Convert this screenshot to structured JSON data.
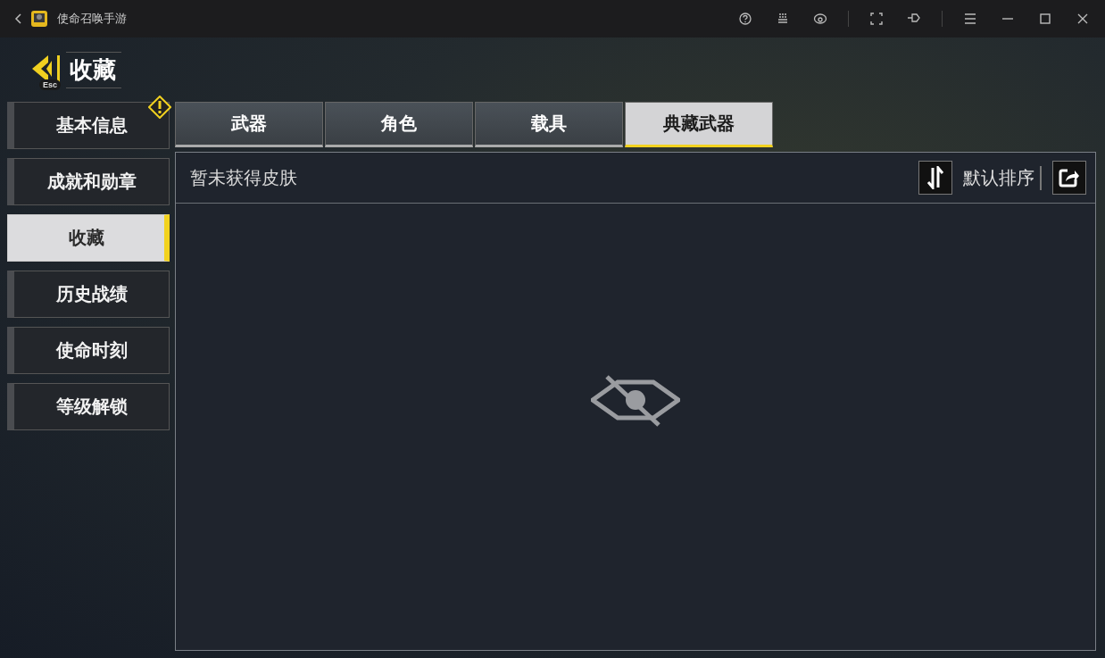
{
  "window": {
    "title": "使命召唤手游"
  },
  "header": {
    "title": "收藏",
    "key_hint": "Esc"
  },
  "sidebar": {
    "items": [
      {
        "label": "基本信息",
        "selected": false,
        "alert": true
      },
      {
        "label": "成就和勋章",
        "selected": false,
        "alert": false
      },
      {
        "label": "收藏",
        "selected": true,
        "alert": false
      },
      {
        "label": "历史战绩",
        "selected": false,
        "alert": false
      },
      {
        "label": "使命时刻",
        "selected": false,
        "alert": false
      },
      {
        "label": "等级解锁",
        "selected": false,
        "alert": false
      }
    ]
  },
  "tabs": [
    {
      "label": "武器",
      "selected": false
    },
    {
      "label": "角色",
      "selected": false
    },
    {
      "label": "载具",
      "selected": false
    },
    {
      "label": "典藏武器",
      "selected": true
    }
  ],
  "panel": {
    "status": "暂未获得皮肤",
    "sort_label": "默认排序"
  }
}
